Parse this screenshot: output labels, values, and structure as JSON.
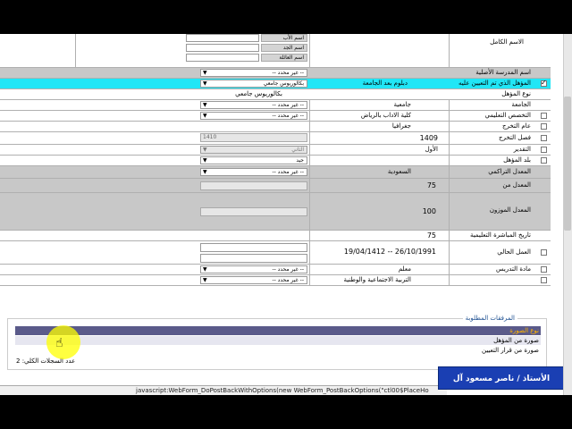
{
  "name_fields": [
    "اسم الأب",
    "اسم الجد",
    "اسم العائلة"
  ],
  "rows": [
    {
      "label": "الاسم الكامل"
    },
    {
      "label": "اسم المدرسة الأصلية",
      "select": "-- غير محدد --"
    },
    {
      "label": "المؤهل الذي تم التعيين عليه",
      "select": "بكالوريوس جامعي",
      "value": "دبلوم بعد الجامعة"
    },
    {
      "label": "نوع المؤهل",
      "value": "بكالوريوس جامعي"
    },
    {
      "label": "الجامعة",
      "select": "-- غير محدد --",
      "value": "جامعية"
    },
    {
      "label": "التخصص التعليمي",
      "select": "-- غير محدد --",
      "value": "كلية الاداب بالرياض"
    },
    {
      "label": "عام التخرج",
      "value": "جغرافيا"
    },
    {
      "label": "فصل التخرج",
      "input": "1410",
      "value": "1409"
    },
    {
      "label": "التقدير",
      "select": "الثاني",
      "value": "الأول"
    },
    {
      "label": "بلد المؤهل",
      "select": "جيد"
    },
    {
      "label": "المعدل التراكمي",
      "select": "-- غير محدد --",
      "value": "السعودية"
    },
    {
      "label": "المعدل من",
      "value": "75"
    },
    {
      "label": "المعدل الموزون",
      "value": "100"
    },
    {
      "label": "تاريخ المباشرة التعليمية",
      "value": "75"
    },
    {
      "label": "العمل الحالي",
      "select": "-- غير محدد --",
      "value": "26/10/1991 -- 19/04/1412"
    },
    {
      "label": "مادة التدريس",
      "select": "-- غير محدد --",
      "value": "معلم"
    },
    {
      "label": "",
      "value": "التربية الاجتماعية والوطنية"
    }
  ],
  "attachments": {
    "legend": "المرفقات المطلوبة",
    "header": "نوع الصورة",
    "items": [
      "صورة من المؤهل",
      "صورة من قرار التعيين"
    ],
    "count": "عدد السجلات الكلي: 2"
  },
  "status_text": "javascript:WebForm_DoPostBackWithOptions(new WebForm_PostBackOptions(\"ctl00$PlaceHo",
  "banner": "الأستاذ / ناصر مسعود آل مستنير"
}
